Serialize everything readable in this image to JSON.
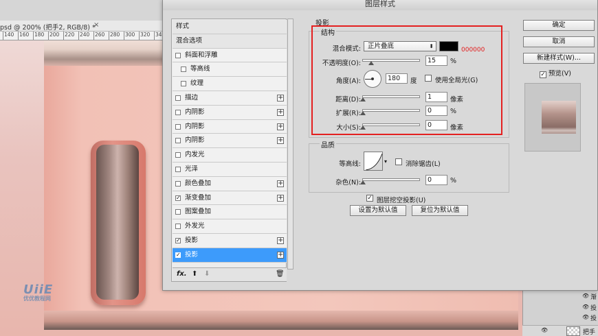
{
  "document": {
    "tab_title": "psd @ 200% (把手2, RGB/8) *",
    "tab_close": "×",
    "ruler_ticks": [
      "140",
      "160",
      "180",
      "200",
      "220",
      "240",
      "260",
      "280",
      "300",
      "320",
      "340",
      "360"
    ]
  },
  "watermark": {
    "logo_text": "UiiE",
    "caption": "优优教程网"
  },
  "dialog": {
    "title": "图层样式",
    "style_list": {
      "items": [
        {
          "label": "样式",
          "type": "header",
          "checked": false,
          "has_plus": false
        },
        {
          "label": "混合选项",
          "type": "header",
          "checked": false,
          "has_plus": false
        },
        {
          "label": "斜面和浮雕",
          "type": "check",
          "checked": false,
          "has_plus": false
        },
        {
          "label": "等高线",
          "type": "sub",
          "checked": false,
          "has_plus": false
        },
        {
          "label": "纹理",
          "type": "sub",
          "checked": false,
          "has_plus": false
        },
        {
          "label": "描边",
          "type": "check",
          "checked": false,
          "has_plus": true
        },
        {
          "label": "内阴影",
          "type": "check",
          "checked": false,
          "has_plus": true
        },
        {
          "label": "内阴影",
          "type": "check",
          "checked": false,
          "has_plus": true
        },
        {
          "label": "内阴影",
          "type": "check",
          "checked": false,
          "has_plus": true
        },
        {
          "label": "内发光",
          "type": "check",
          "checked": false,
          "has_plus": false
        },
        {
          "label": "光泽",
          "type": "check",
          "checked": false,
          "has_plus": false
        },
        {
          "label": "颜色叠加",
          "type": "check",
          "checked": false,
          "has_plus": true
        },
        {
          "label": "渐变叠加",
          "type": "check",
          "checked": true,
          "has_plus": true
        },
        {
          "label": "图案叠加",
          "type": "check",
          "checked": false,
          "has_plus": false
        },
        {
          "label": "外发光",
          "type": "check",
          "checked": false,
          "has_plus": false
        },
        {
          "label": "投影",
          "type": "check",
          "checked": true,
          "has_plus": true
        },
        {
          "label": "投影",
          "type": "check",
          "checked": true,
          "has_plus": true,
          "selected": true
        }
      ],
      "footer": {
        "fx": "fx.",
        "up": "⬆",
        "down": "⬇",
        "trash": "🗑"
      }
    },
    "buttons": {
      "ok": "确定",
      "cancel": "取消",
      "new_style": "新建样式(W)...",
      "preview": "预览(V)"
    },
    "preview_checked": true,
    "drop_shadow": {
      "section_title": "投影",
      "structure": {
        "group_title": "结构",
        "blend_mode_label": "混合模式:",
        "blend_mode_value": "正片叠底",
        "color": "#000000",
        "color_hex_note": "000000",
        "opacity_label": "不透明度(O):",
        "opacity_value": "15",
        "opacity_unit": "%",
        "opacity_level": 15,
        "angle_label": "角度(A):",
        "angle_value": "180",
        "angle_unit": "度",
        "global_light_label": "使用全局光(G)",
        "global_light_checked": false,
        "distance_label": "距离(D):",
        "distance_value": "1",
        "distance_unit": "像素",
        "spread_label": "扩展(R):",
        "spread_value": "0",
        "spread_unit": "%",
        "size_label": "大小(S):",
        "size_value": "0",
        "size_unit": "像素"
      },
      "quality": {
        "group_title": "品质",
        "contour_label": "等高线:",
        "anti_alias_label": "消除锯齿(L)",
        "anti_alias_checked": false,
        "noise_label": "杂色(N):",
        "noise_value": "0",
        "noise_unit": "%"
      },
      "knockout_label": "图层挖空投影(U)",
      "knockout_checked": true,
      "make_default": "设置为默认值",
      "reset_default": "复位为默认值"
    }
  },
  "layers_panel": {
    "rows": [
      "渐",
      "投",
      "投"
    ],
    "main_layer_name": "把手"
  },
  "colors": {
    "highlight_box": "#e41f1f",
    "selected_item": "#3d9bfb"
  }
}
